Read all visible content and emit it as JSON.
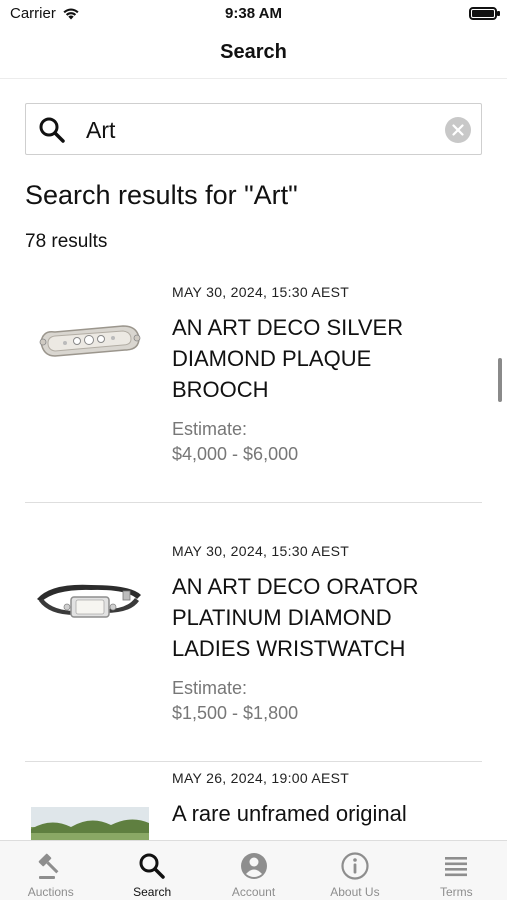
{
  "status_bar": {
    "carrier": "Carrier",
    "time": "9:38 AM"
  },
  "nav": {
    "title": "Search"
  },
  "search": {
    "value": "Art"
  },
  "results": {
    "title": "Search results for \"Art\"",
    "count": "78 results",
    "items": [
      {
        "date": "MAY 30, 2024, 15:30 AEST",
        "title_lines": [
          "AN ART DECO SILVER",
          "DIAMOND PLAQUE",
          "BROOCH"
        ],
        "estimate_label": "Estimate:",
        "estimate_value": "$4,000 - $6,000",
        "thumbnail": "brooch-image"
      },
      {
        "date": "MAY 30, 2024, 15:30 AEST",
        "title_lines": [
          "AN ART DECO ORATOR",
          "PLATINUM DIAMOND",
          "LADIES WRISTWATCH"
        ],
        "estimate_label": "Estimate:",
        "estimate_value": "$1,500 - $1,800",
        "thumbnail": "wristwatch-image"
      },
      {
        "date": "MAY 26, 2024, 19:00 AEST",
        "title_lines": [
          "A rare unframed original"
        ],
        "thumbnail": "landscape-painting-image"
      }
    ]
  },
  "tabs": [
    {
      "label": "Auctions",
      "icon": "gavel-icon",
      "active": false
    },
    {
      "label": "Search",
      "icon": "search-icon",
      "active": true
    },
    {
      "label": "Account",
      "icon": "account-icon",
      "active": false
    },
    {
      "label": "About Us",
      "icon": "info-icon",
      "active": false
    },
    {
      "label": "Terms",
      "icon": "terms-icon",
      "active": false
    }
  ],
  "colors": {
    "accent": "#111111",
    "muted": "#8e8e8e",
    "estimate": "#777777"
  }
}
